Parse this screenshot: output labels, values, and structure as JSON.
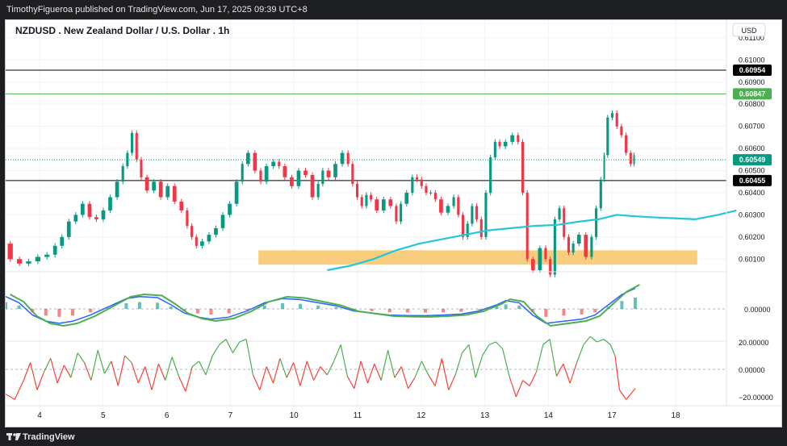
{
  "header": {
    "publisher_line": "TimothyFigueroa published on TradingView.com, Jun 17, 2025 09:39 UTC+8"
  },
  "footer": {
    "brand": "TradingView"
  },
  "chart_data": {
    "type": "candlestick",
    "title": "NZDUSD . New Zealand Dollar / U.S. Dollar . 1h",
    "currency": "USD",
    "price_axis": {
      "ticks": [
        "0.61100",
        "0.61000",
        "0.60900",
        "0.60800",
        "0.60700",
        "0.60600",
        "0.60500",
        "0.60400",
        "0.60300",
        "0.60200",
        "0.60100"
      ],
      "range": [
        0.6005,
        0.6118
      ]
    },
    "horizontal_lines": [
      {
        "label": "0.60954",
        "value": 0.60954,
        "color": "#000000"
      },
      {
        "label": "0.60847",
        "value": 0.60847,
        "color": "#4caf50"
      },
      {
        "label": "0.60455",
        "value": 0.60455,
        "color": "#000000"
      }
    ],
    "current_price": {
      "label": "0.60549",
      "value": 0.60549,
      "color": "#089981"
    },
    "support_zone": {
      "from": 0.60075,
      "to": 0.6014,
      "x_start": 5.5,
      "x_end": 15.05,
      "color": "#f8c05e"
    },
    "moving_average": {
      "color": "#26c6da",
      "points": [
        [
          7.0,
          0.6005
        ],
        [
          7.5,
          0.6007
        ],
        [
          8.0,
          0.601
        ],
        [
          8.5,
          0.6014
        ],
        [
          9.0,
          0.6017
        ],
        [
          9.5,
          0.6019
        ],
        [
          10.0,
          0.6021
        ],
        [
          10.5,
          0.6023
        ],
        [
          11.0,
          0.6024
        ],
        [
          11.5,
          0.6025
        ],
        [
          12.0,
          0.60255
        ],
        [
          12.5,
          0.6027
        ],
        [
          12.9,
          0.6028
        ],
        [
          13.3,
          0.603
        ],
        [
          13.6,
          0.60295
        ],
        [
          14.0,
          0.6029
        ],
        [
          14.5,
          0.60285
        ],
        [
          15.0,
          0.6028
        ],
        [
          15.5,
          0.603
        ],
        [
          15.9,
          0.6032
        ]
      ]
    },
    "x_axis": {
      "ticks": [
        "4",
        "5",
        "6",
        "7",
        "10",
        "11",
        "12",
        "13",
        "14",
        "17",
        "18"
      ],
      "positions": [
        4,
        5,
        6,
        7,
        8,
        9,
        10,
        11,
        12,
        13,
        14
      ]
    },
    "price_path": [
      [
        0.0,
        0.6017
      ],
      [
        0.2,
        0.601
      ],
      [
        0.4,
        0.6008
      ],
      [
        0.6,
        0.6009
      ],
      [
        0.8,
        0.6011
      ],
      [
        1.0,
        0.6012
      ],
      [
        1.15,
        0.6016
      ],
      [
        1.3,
        0.602
      ],
      [
        1.45,
        0.6027
      ],
      [
        1.6,
        0.603
      ],
      [
        1.75,
        0.6035
      ],
      [
        1.9,
        0.6029
      ],
      [
        2.05,
        0.6028
      ],
      [
        2.2,
        0.6032
      ],
      [
        2.35,
        0.6038
      ],
      [
        2.5,
        0.6045
      ],
      [
        2.6,
        0.6052
      ],
      [
        2.7,
        0.6058
      ],
      [
        2.8,
        0.6067
      ],
      [
        2.9,
        0.6055
      ],
      [
        3.0,
        0.6047
      ],
      [
        3.15,
        0.6041
      ],
      [
        3.3,
        0.6045
      ],
      [
        3.45,
        0.6038
      ],
      [
        3.6,
        0.6043
      ],
      [
        3.75,
        0.6036
      ],
      [
        3.9,
        0.6032
      ],
      [
        4.0,
        0.6025
      ],
      [
        4.1,
        0.602
      ],
      [
        4.2,
        0.6016
      ],
      [
        4.35,
        0.6018
      ],
      [
        4.5,
        0.6021
      ],
      [
        4.65,
        0.6024
      ],
      [
        4.8,
        0.603
      ],
      [
        4.95,
        0.6035
      ],
      [
        5.1,
        0.6045
      ],
      [
        5.2,
        0.6053
      ],
      [
        5.35,
        0.6058
      ],
      [
        5.5,
        0.605
      ],
      [
        5.6,
        0.6045
      ],
      [
        5.75,
        0.6052
      ],
      [
        5.9,
        0.6054
      ],
      [
        6.0,
        0.6052
      ],
      [
        6.15,
        0.6047
      ],
      [
        6.3,
        0.6043
      ],
      [
        6.45,
        0.605
      ],
      [
        6.6,
        0.6048
      ],
      [
        6.75,
        0.6038
      ],
      [
        6.85,
        0.6044
      ],
      [
        6.95,
        0.605
      ],
      [
        7.1,
        0.6047
      ],
      [
        7.25,
        0.6053
      ],
      [
        7.4,
        0.6058
      ],
      [
        7.5,
        0.6053
      ],
      [
        7.6,
        0.6044
      ],
      [
        7.7,
        0.6038
      ],
      [
        7.8,
        0.6034
      ],
      [
        7.9,
        0.6039
      ],
      [
        8.0,
        0.6037
      ],
      [
        8.15,
        0.6032
      ],
      [
        8.3,
        0.6037
      ],
      [
        8.45,
        0.6034
      ],
      [
        8.55,
        0.6027
      ],
      [
        8.65,
        0.6035
      ],
      [
        8.8,
        0.604
      ],
      [
        8.9,
        0.6047
      ],
      [
        9.0,
        0.6046
      ],
      [
        9.1,
        0.6043
      ],
      [
        9.2,
        0.604
      ],
      [
        9.3,
        0.604
      ],
      [
        9.4,
        0.6037
      ],
      [
        9.55,
        0.6031
      ],
      [
        9.7,
        0.6034
      ],
      [
        9.8,
        0.6038
      ],
      [
        9.9,
        0.603
      ],
      [
        10.0,
        0.602
      ],
      [
        10.1,
        0.6026
      ],
      [
        10.2,
        0.6034
      ],
      [
        10.3,
        0.6028
      ],
      [
        10.4,
        0.602
      ],
      [
        10.5,
        0.604
      ],
      [
        10.6,
        0.6056
      ],
      [
        10.7,
        0.6063
      ],
      [
        10.8,
        0.6061
      ],
      [
        10.95,
        0.6063
      ],
      [
        11.1,
        0.6066
      ],
      [
        11.2,
        0.6063
      ],
      [
        11.3,
        0.604
      ],
      [
        11.4,
        0.601
      ],
      [
        11.55,
        0.6005
      ],
      [
        11.7,
        0.6015
      ],
      [
        11.8,
        0.601
      ],
      [
        11.9,
        0.6003
      ],
      [
        12.0,
        0.6028
      ],
      [
        12.1,
        0.6033
      ],
      [
        12.2,
        0.602
      ],
      [
        12.3,
        0.6013
      ],
      [
        12.4,
        0.6017
      ],
      [
        12.55,
        0.6021
      ],
      [
        12.7,
        0.6011
      ],
      [
        12.8,
        0.602
      ],
      [
        12.9,
        0.6033
      ],
      [
        13.0,
        0.6046
      ],
      [
        13.05,
        0.6057
      ],
      [
        13.15,
        0.6074
      ],
      [
        13.25,
        0.6076
      ],
      [
        13.35,
        0.607
      ],
      [
        13.45,
        0.6066
      ],
      [
        13.55,
        0.6058
      ],
      [
        13.65,
        0.6053
      ],
      [
        13.7,
        0.6057
      ]
    ],
    "oscillator_panel": {
      "type": "histogram+line",
      "zero_label": "0.00000",
      "fast_line_color": "#4caf50",
      "slow_line_color": "#2962ff",
      "bearish_line_color": "#b71c1c",
      "histogram_positive_color": "#26a69a",
      "histogram_negative_color": "#ef5350",
      "lines_points": [
        [
          0.0,
          0.6
        ],
        [
          0.3,
          0.3
        ],
        [
          0.6,
          -0.3
        ],
        [
          0.9,
          -0.6
        ],
        [
          1.2,
          -0.7
        ],
        [
          1.5,
          -0.6
        ],
        [
          1.9,
          -0.3
        ],
        [
          2.3,
          0.1
        ],
        [
          2.7,
          0.5
        ],
        [
          3.0,
          0.6
        ],
        [
          3.4,
          0.55
        ],
        [
          3.7,
          0.2
        ],
        [
          4.0,
          -0.2
        ],
        [
          4.3,
          -0.4
        ],
        [
          4.6,
          -0.5
        ],
        [
          5.0,
          -0.4
        ],
        [
          5.4,
          -0.1
        ],
        [
          5.8,
          0.3
        ],
        [
          6.2,
          0.5
        ],
        [
          6.6,
          0.45
        ],
        [
          7.0,
          0.3
        ],
        [
          7.4,
          0.15
        ],
        [
          7.8,
          -0.1
        ],
        [
          8.2,
          -0.2
        ],
        [
          8.6,
          -0.3
        ],
        [
          9.0,
          -0.32
        ],
        [
          9.4,
          -0.33
        ],
        [
          9.8,
          -0.3
        ],
        [
          10.2,
          -0.25
        ],
        [
          10.6,
          -0.1
        ],
        [
          11.0,
          0.2
        ],
        [
          11.2,
          0.4
        ],
        [
          11.5,
          0.3
        ],
        [
          11.8,
          -0.3
        ],
        [
          12.1,
          -0.7
        ],
        [
          12.5,
          -0.6
        ],
        [
          12.9,
          -0.5
        ],
        [
          13.2,
          -0.3
        ],
        [
          13.5,
          0.2
        ],
        [
          13.8,
          0.7
        ],
        [
          14.1,
          1.0
        ]
      ]
    },
    "rsi_panel": {
      "ticks": [
        "20.00000",
        "0.00000",
        "−20.00000"
      ],
      "range": [
        -28,
        28
      ],
      "line_color_positive": "#4caf50",
      "line_color_negative": "#f44336",
      "points": [
        [
          0.0,
          -18
        ],
        [
          0.2,
          -22
        ],
        [
          0.4,
          -8
        ],
        [
          0.55,
          5
        ],
        [
          0.7,
          -15
        ],
        [
          0.85,
          -2
        ],
        [
          1.0,
          8
        ],
        [
          1.15,
          -10
        ],
        [
          1.3,
          3
        ],
        [
          1.45,
          -6
        ],
        [
          1.6,
          12
        ],
        [
          1.75,
          5
        ],
        [
          1.9,
          -8
        ],
        [
          2.05,
          14
        ],
        [
          2.2,
          -3
        ],
        [
          2.35,
          6
        ],
        [
          2.5,
          -12
        ],
        [
          2.65,
          10
        ],
        [
          2.8,
          5
        ],
        [
          2.95,
          -10
        ],
        [
          3.1,
          2
        ],
        [
          3.25,
          -15
        ],
        [
          3.4,
          4
        ],
        [
          3.55,
          -8
        ],
        [
          3.7,
          9
        ],
        [
          3.85,
          -5
        ],
        [
          4.0,
          -16
        ],
        [
          4.15,
          2
        ],
        [
          4.3,
          6
        ],
        [
          4.45,
          -4
        ],
        [
          4.6,
          10
        ],
        [
          4.75,
          18
        ],
        [
          4.9,
          22
        ],
        [
          5.05,
          12
        ],
        [
          5.2,
          20
        ],
        [
          5.35,
          22
        ],
        [
          5.5,
          -4
        ],
        [
          5.65,
          -15
        ],
        [
          5.8,
          2
        ],
        [
          5.95,
          -10
        ],
        [
          6.1,
          8
        ],
        [
          6.25,
          -6
        ],
        [
          6.4,
          5
        ],
        [
          6.55,
          -12
        ],
        [
          6.7,
          6
        ],
        [
          6.85,
          -8
        ],
        [
          7.0,
          2
        ],
        [
          7.15,
          -4
        ],
        [
          7.3,
          6
        ],
        [
          7.45,
          18
        ],
        [
          7.6,
          -5
        ],
        [
          7.75,
          -14
        ],
        [
          7.9,
          6
        ],
        [
          8.05,
          -10
        ],
        [
          8.2,
          4
        ],
        [
          8.35,
          -8
        ],
        [
          8.5,
          14
        ],
        [
          8.65,
          -6
        ],
        [
          8.8,
          2
        ],
        [
          8.95,
          -14
        ],
        [
          9.1,
          -6
        ],
        [
          9.25,
          6
        ],
        [
          9.4,
          -4
        ],
        [
          9.55,
          -12
        ],
        [
          9.7,
          8
        ],
        [
          9.85,
          -15
        ],
        [
          10.0,
          -4
        ],
        [
          10.15,
          12
        ],
        [
          10.3,
          18
        ],
        [
          10.45,
          -6
        ],
        [
          10.6,
          10
        ],
        [
          10.75,
          18
        ],
        [
          10.9,
          20
        ],
        [
          11.05,
          15
        ],
        [
          11.2,
          -5
        ],
        [
          11.35,
          -20
        ],
        [
          11.5,
          -8
        ],
        [
          11.65,
          -12
        ],
        [
          11.8,
          -2
        ],
        [
          11.95,
          18
        ],
        [
          12.1,
          22
        ],
        [
          12.25,
          -5
        ],
        [
          12.4,
          4
        ],
        [
          12.55,
          -10
        ],
        [
          12.7,
          5
        ],
        [
          12.85,
          18
        ],
        [
          13.0,
          24
        ],
        [
          13.15,
          20
        ],
        [
          13.3,
          22
        ],
        [
          13.45,
          18
        ],
        [
          13.55,
          10
        ],
        [
          13.65,
          -15
        ],
        [
          13.8,
          -22
        ],
        [
          13.9,
          -18
        ],
        [
          14.0,
          -14
        ]
      ]
    }
  }
}
